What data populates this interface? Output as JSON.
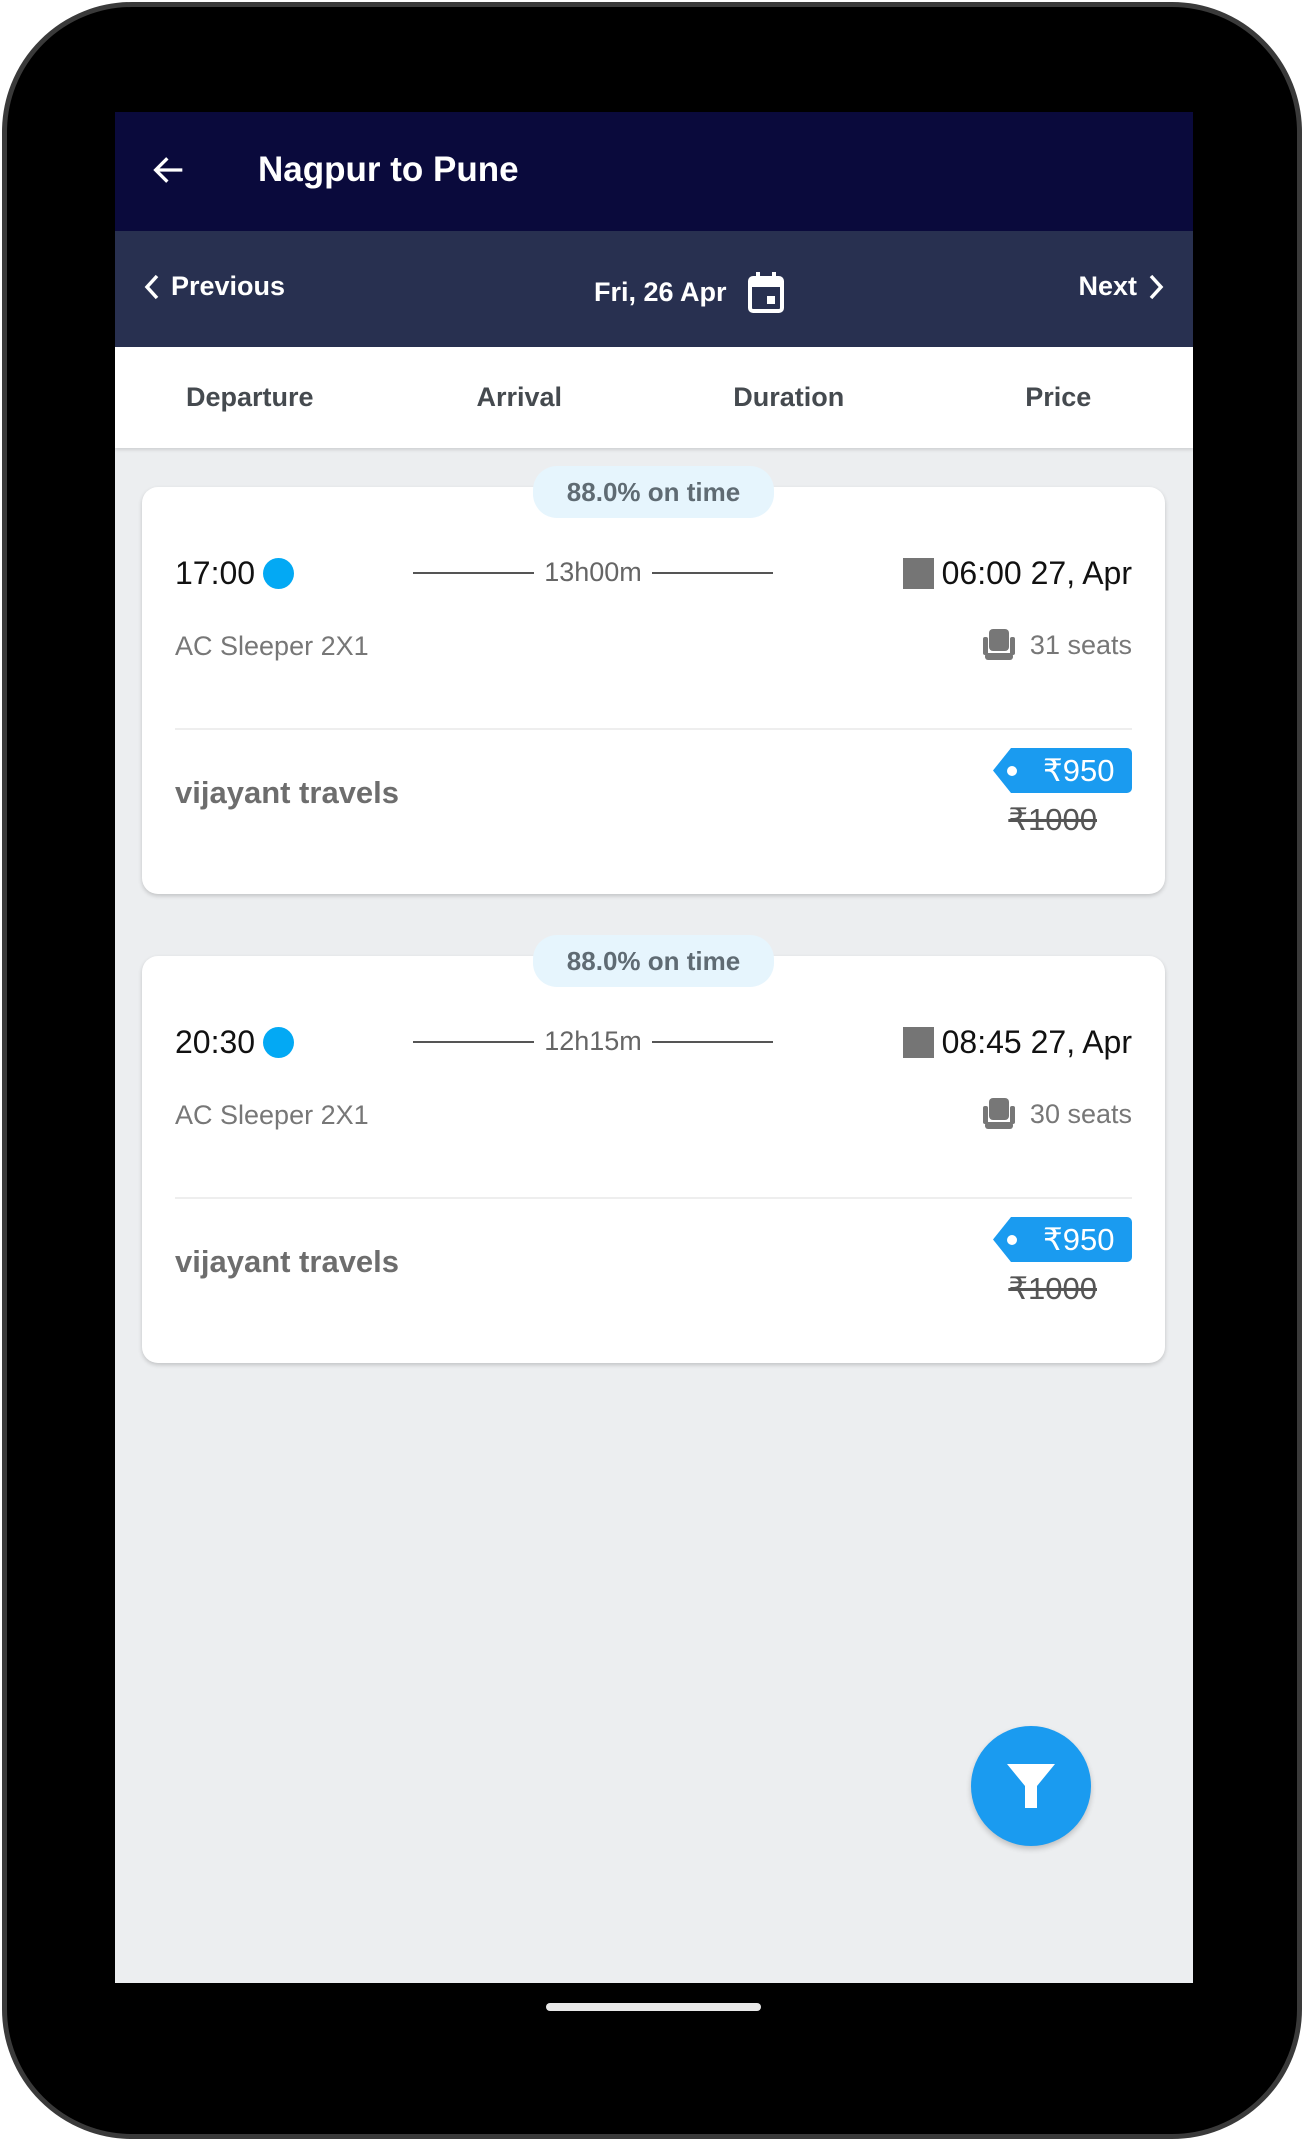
{
  "header": {
    "title": "Nagpur to Pune",
    "back_icon": "arrow-left-icon"
  },
  "datebar": {
    "previous_label": "Previous",
    "date": "Fri, 26 Apr",
    "next_label": "Next",
    "calendar_icon": "calendar-icon"
  },
  "sort_tabs": [
    {
      "label": "Departure"
    },
    {
      "label": "Arrival"
    },
    {
      "label": "Duration"
    },
    {
      "label": "Price"
    }
  ],
  "results": [
    {
      "on_time": "88.0% on time",
      "departure": "17:00",
      "duration": "13h00m",
      "arrival": "06:00 27, Apr",
      "bus_type": "AC Sleeper 2X1",
      "seats": "31 seats",
      "operator": "vijayant travels",
      "price": "₹950",
      "original_price": "₹1000"
    },
    {
      "on_time": "88.0% on time",
      "departure": "20:30",
      "duration": "12h15m",
      "arrival": "08:45 27, Apr",
      "bus_type": "AC Sleeper 2X1",
      "seats": "30 seats",
      "operator": "vijayant travels",
      "price": "₹950",
      "original_price": "₹1000"
    }
  ],
  "fab": {
    "icon": "filter-icon"
  },
  "colors": {
    "appbar": "#0a0a3c",
    "datebar": "#283050",
    "accent": "#1a9bf0",
    "departure_dot": "#03a9f4"
  }
}
